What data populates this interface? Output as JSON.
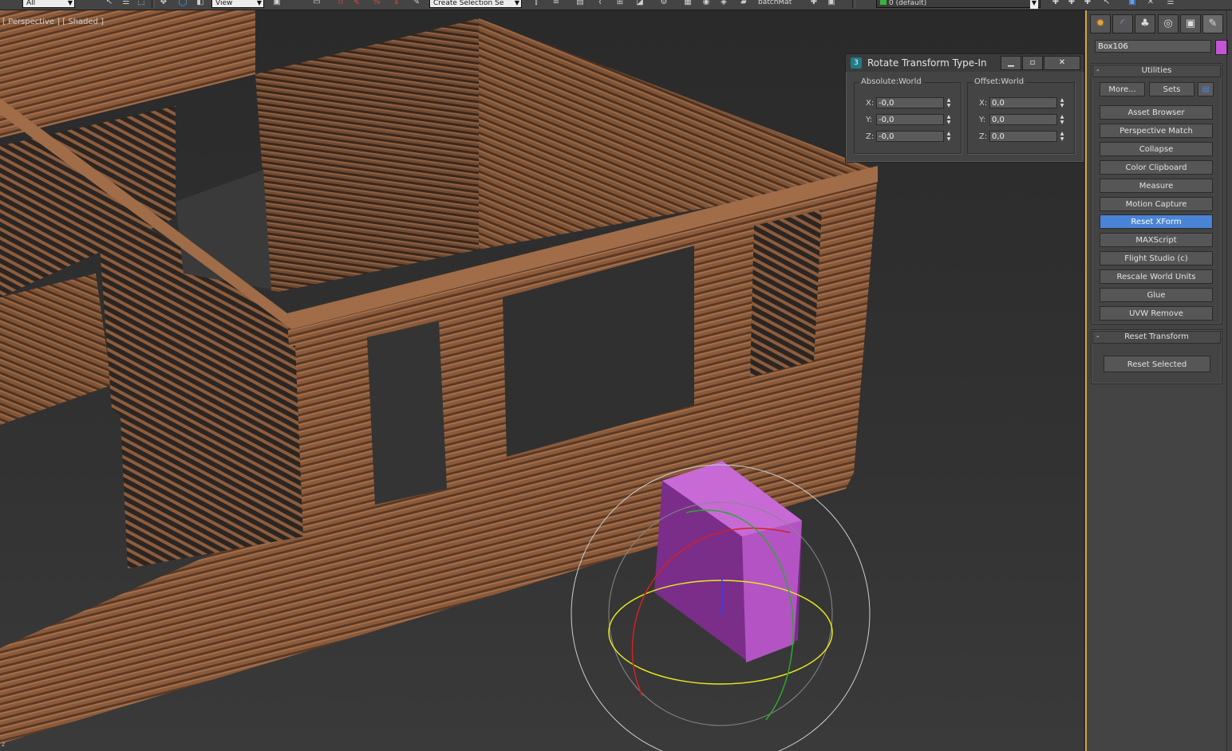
{
  "toolbar": {
    "filter_value": "All",
    "refcoord_value": "View",
    "selection_set_value": "Create Selection Se",
    "material_label": "batchMat",
    "layer_value": "0 (default)"
  },
  "viewport": {
    "label": "[ Perspective ] [ Shaded ]",
    "axis_label": "z"
  },
  "rotate_dialog": {
    "title": "Rotate Transform Type-In",
    "absolute": {
      "label": "Absolute:World",
      "x_label": "X:",
      "x": "-0,0",
      "y_label": "Y:",
      "y": "-0,0",
      "z_label": "Z:",
      "z": "-0,0"
    },
    "offset": {
      "label": "Offset:World",
      "x_label": "X:",
      "x": "0,0",
      "y_label": "Y:",
      "y": "0,0",
      "z_label": "Z:",
      "z": "0,0"
    }
  },
  "command_panel": {
    "object_name": "Box106",
    "object_color": "#c553d6",
    "utilities": {
      "title": "Utilities",
      "more_label": "More...",
      "sets_label": "Sets",
      "items": [
        {
          "label": "Asset Browser"
        },
        {
          "label": "Perspective Match"
        },
        {
          "label": "Collapse"
        },
        {
          "label": "Color Clipboard"
        },
        {
          "label": "Measure"
        },
        {
          "label": "Motion Capture"
        },
        {
          "label": "Reset XForm",
          "selected": true
        },
        {
          "label": "MAXScript"
        },
        {
          "label": "Flight Studio (c)"
        },
        {
          "label": "Rescale World Units"
        },
        {
          "label": "Glue"
        },
        {
          "label": "UVW Remove"
        }
      ]
    },
    "reset_transform": {
      "title": "Reset Transform",
      "button_label": "Reset Selected"
    }
  },
  "colors": {
    "accent_selected": "#4a84d6",
    "panel_border": "#d9a441",
    "gizmo_x": "#d42020",
    "gizmo_y": "#2ea82e",
    "gizmo_z": "#e8e81e"
  }
}
